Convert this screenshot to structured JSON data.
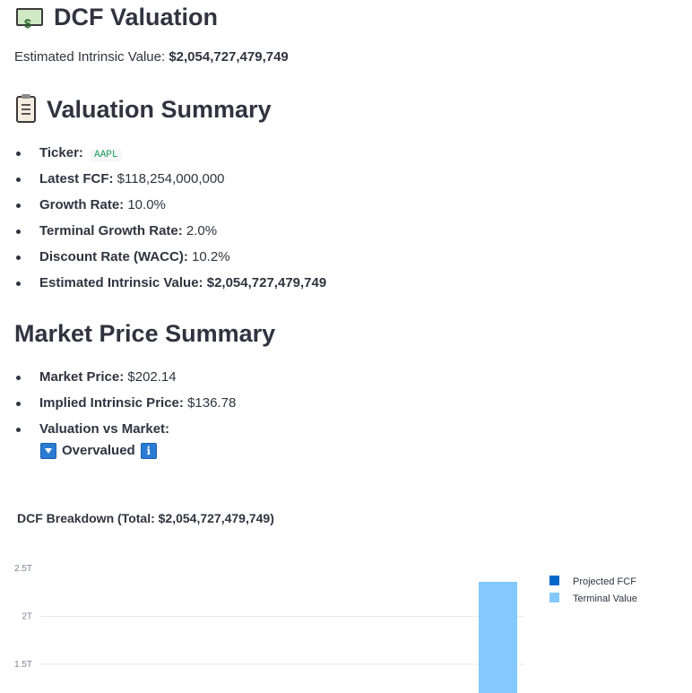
{
  "header": {
    "title": "DCF Valuation",
    "icon": "dollar-banknote-icon",
    "intrinsic_label": "Estimated Intrinsic Value:",
    "intrinsic_value": "$2,054,727,479,749"
  },
  "valuation_summary": {
    "title": "Valuation Summary",
    "icon": "clipboard-icon",
    "items": [
      {
        "label": "Ticker:",
        "value": "AAPL"
      },
      {
        "label": "Latest FCF:",
        "value": "$118,254,000,000"
      },
      {
        "label": "Growth Rate:",
        "value": "10.0%"
      },
      {
        "label": "Terminal Growth Rate:",
        "value": "2.0%"
      },
      {
        "label": "Discount Rate (WACC):",
        "value": "10.2%"
      },
      {
        "label": "Estimated Intrinsic Value:",
        "value": "$2,054,727,479,749"
      }
    ]
  },
  "market_summary": {
    "title": "Market Price Summary",
    "items": [
      {
        "label": "Market Price:",
        "value": "$202.14"
      },
      {
        "label": "Implied Intrinsic Price:",
        "value": "$136.78"
      },
      {
        "label": "Valuation vs Market:",
        "value": ""
      }
    ],
    "status_label": "Overvalued",
    "status_icon": "down-arrow-icon",
    "info_icon": "info-icon",
    "status_color": "#2a7bd4"
  },
  "chart_data": {
    "type": "bar",
    "title": "DCF Breakdown (Total: $2,054,727,479,749)",
    "y_ticks": [
      "2.5T",
      "2T",
      "1.5T"
    ],
    "y_tick_values": [
      2.5,
      2.0,
      1.5
    ],
    "ylim": [
      1.22,
      2.5
    ],
    "series": [
      {
        "name": "Projected FCF",
        "color": "#0068c9",
        "values": [
          null
        ]
      },
      {
        "name": "Terminal Value",
        "color": "#83c9ff",
        "values": [
          2.36
        ]
      }
    ],
    "legend_position": "top-right",
    "grid": true
  }
}
